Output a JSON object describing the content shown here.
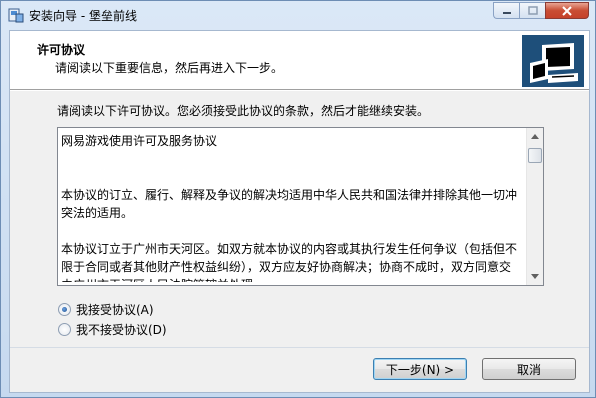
{
  "window": {
    "title": "安装向导 - 堡垒前线"
  },
  "header": {
    "title": "许可协议",
    "subtitle": "请阅读以下重要信息，然后再进入下一步。"
  },
  "main": {
    "instruction": "请阅读以下许可协议。您必须接受此协议的条款，然后才能继续安装。",
    "license_paragraphs": [
      "网易游戏使用许可及服务协议",
      "",
      "",
      "本协议的订立、履行、解释及争议的解决均适用中华人民共和国法律并排除其他一切冲突法的适用。",
      "",
      "本协议订立于广州市天河区。如双方就本协议的内容或其执行发生任何争议（包括但不限于合同或者其他财产性权益纠纷），双方应友好协商解决；协商不成时，双方同意交由广州市天河区人民法院管辖并处理。"
    ],
    "accept_label": "我接受协议(A)",
    "decline_label": "我不接受协议(D)",
    "accept_selected": true
  },
  "buttons": {
    "next": "下一步(N) >",
    "cancel": "取消"
  }
}
